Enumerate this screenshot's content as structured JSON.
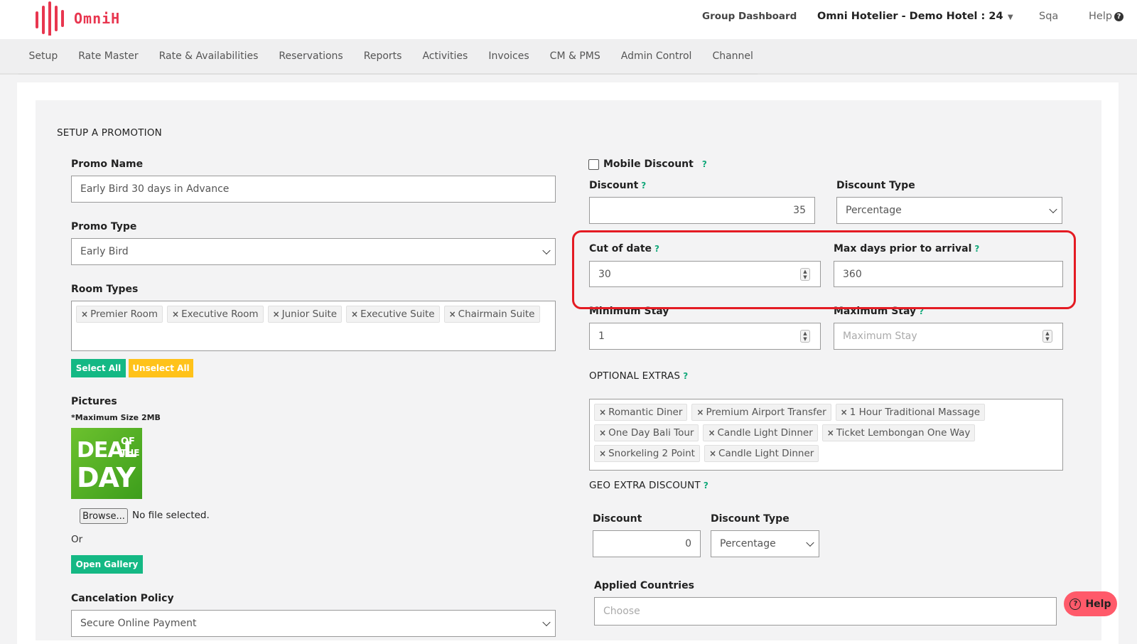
{
  "header": {
    "logo_text": "OmniH",
    "group_dashboard": "Group Dashboard",
    "hotel": "Omni Hotelier - Demo Hotel : 24",
    "user": "Sqa",
    "help": "Help",
    "help_glyph": "?"
  },
  "menu": [
    "Setup",
    "Rate Master",
    "Rate & Availabilities",
    "Reservations",
    "Reports",
    "Activities",
    "Invoices",
    "CM & PMS",
    "Admin Control",
    "Channel"
  ],
  "form": {
    "title": "SETUP A PROMOTION",
    "promo_name_label": "Promo Name",
    "promo_name_value": "Early Bird 30 days in Advance",
    "promo_type_label": "Promo Type",
    "promo_type_value": "Early Bird",
    "room_types_label": "Room Types",
    "room_types": [
      "Premier Room",
      "Executive Room",
      "Junior Suite",
      "Executive Suite",
      "Chairmain Suite"
    ],
    "select_all": "Select All",
    "unselect_all": "Unselect All",
    "pictures_label": "Pictures",
    "max_size": "*Maximum Size 2MB",
    "deal_line1": "DEAL",
    "deal_of": "OF",
    "deal_the": "THE",
    "deal_line2": "DAY",
    "browse": "Browse...",
    "no_file": "No file selected.",
    "or": "Or",
    "open_gallery": "Open Gallery",
    "cancel_policy_label": "Cancelation Policy",
    "cancel_policy_value": "Secure Online Payment",
    "mobile_discount": "Mobile Discount",
    "discount_label": "Discount",
    "discount_value": "35",
    "discount_type_label": "Discount Type",
    "discount_type_value": "Percentage",
    "cutoff_label": "Cut of date",
    "cutoff_value": "30",
    "max_days_label": "Max days prior to arrival",
    "max_days_value": "360",
    "min_stay_label": "Minimum Stay",
    "min_stay_value": "1",
    "max_stay_label": "Maximum Stay",
    "max_stay_placeholder": "Maximum Stay",
    "optional_extras_label": "OPTIONAL EXTRAS",
    "optional_extras": [
      "Romantic Diner",
      "Premium Airport Transfer",
      "1 Hour Traditional Massage",
      "One Day Bali Tour",
      "Candle Light Dinner",
      "Ticket Lembongan One Way",
      "Snorkeling 2 Point",
      "Candle Light Dinner"
    ],
    "geo_label": "GEO EXTRA DISCOUNT",
    "geo_discount_label": "Discount",
    "geo_discount_value": "0",
    "geo_type_label": "Discount Type",
    "geo_type_value": "Percentage",
    "applied_countries_label": "Applied Countries",
    "applied_countries_placeholder": "Choose",
    "help_button": "Help"
  }
}
